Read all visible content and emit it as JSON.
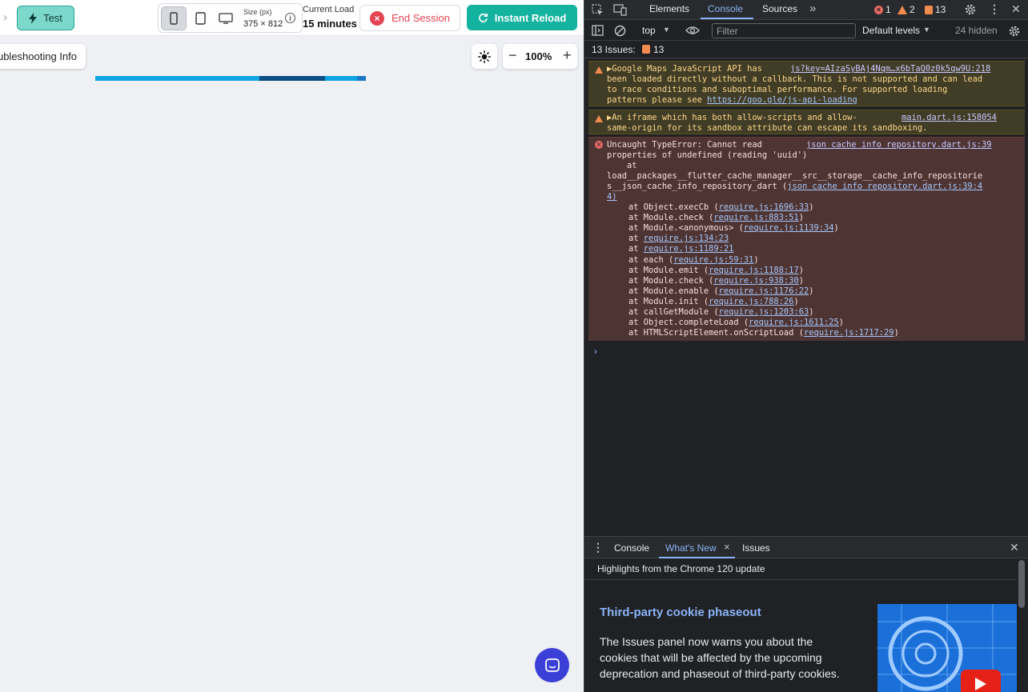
{
  "app": {
    "test_label": "Test",
    "size_label": "Size (px)",
    "size_value": "375 × 812",
    "load_label": "Current Load",
    "load_value": "15 minutes",
    "end_session_label": "End Session",
    "instant_reload_label": "Instant Reload",
    "troubleshooting_label": "Troubleshooting Info",
    "zoom_value": "100%",
    "colors": {
      "accent": "#14b3a0",
      "danger": "#e44552",
      "fab": "#3b3fd8"
    }
  },
  "devtools": {
    "tabs": [
      "Elements",
      "Console",
      "Sources"
    ],
    "active_tab": "Console",
    "error_count": "1",
    "warning_count": "2",
    "issue_count": "13",
    "context": "top",
    "filter_placeholder": "Filter",
    "levels": "Default levels",
    "hidden": "24 hidden",
    "issues_label": "13 Issues:",
    "issues_badge": "13",
    "messages": {
      "warn1_lines": [
        "Google Maps JavaScript API has",
        "been loaded directly without a callback. This is not supported and can lead",
        "to race conditions and suboptimal performance. For supported loading",
        "patterns please see "
      ],
      "warn1_link": "https://goo.gle/js-api-loading",
      "warn1_src": "js?key=AIzaSyBAj4Nqm…x6bTaQ0z0k5qw9U:218",
      "warn2_lines": [
        "An iframe which has both allow-scripts and allow-",
        "same-origin for its sandbox attribute can escape its sandboxing."
      ],
      "warn2_src": "main.dart.js:158054",
      "err_lines": [
        "Uncaught TypeError: Cannot read",
        "properties of undefined (reading 'uuid')",
        "    at",
        "load__packages__flutter_cache_manager__src__storage__cache_info_repositorie",
        "s__json_cache_info_repository_dart ("
      ],
      "err_src": "json cache info repository.dart.js:39",
      "err_link": "json cache info repository.dart.js:39:4",
      "err_link_tail": "4)",
      "trace": [
        {
          "pre": "at Object.execCb (",
          "link": "require.js:1696:33",
          "post": ")"
        },
        {
          "pre": "at Module.check (",
          "link": "require.js:883:51",
          "post": ")"
        },
        {
          "pre": "at Module.<anonymous> (",
          "link": "require.js:1139:34",
          "post": ")"
        },
        {
          "pre": "at ",
          "link": "require.js:134:23",
          "post": ""
        },
        {
          "pre": "at ",
          "link": "require.js:1189:21",
          "post": ""
        },
        {
          "pre": "at each (",
          "link": "require.js:59:31",
          "post": ")"
        },
        {
          "pre": "at Module.emit (",
          "link": "require.js:1188:17",
          "post": ")"
        },
        {
          "pre": "at Module.check (",
          "link": "require.js:938:30",
          "post": ")"
        },
        {
          "pre": "at Module.enable (",
          "link": "require.js:1176:22",
          "post": ")"
        },
        {
          "pre": "at Module.init (",
          "link": "require.js:788:26",
          "post": ")"
        },
        {
          "pre": "at callGetModule (",
          "link": "require.js:1203:63",
          "post": ")"
        },
        {
          "pre": "at Object.completeLoad (",
          "link": "require.js:1611:25",
          "post": ")"
        },
        {
          "pre": "at HTMLScriptElement.onScriptLoad (",
          "link": "require.js:1717:29",
          "post": ")"
        }
      ]
    },
    "drawer": {
      "tabs": [
        "Console",
        "What's New",
        "Issues"
      ],
      "active": "What's New",
      "highlights": "Highlights from the Chrome 120 update",
      "title": "Third-party cookie phaseout",
      "body": "The Issues panel now warns you about the cookies that will be affected by the upcoming deprecation and phaseout of third-party cookies."
    }
  }
}
